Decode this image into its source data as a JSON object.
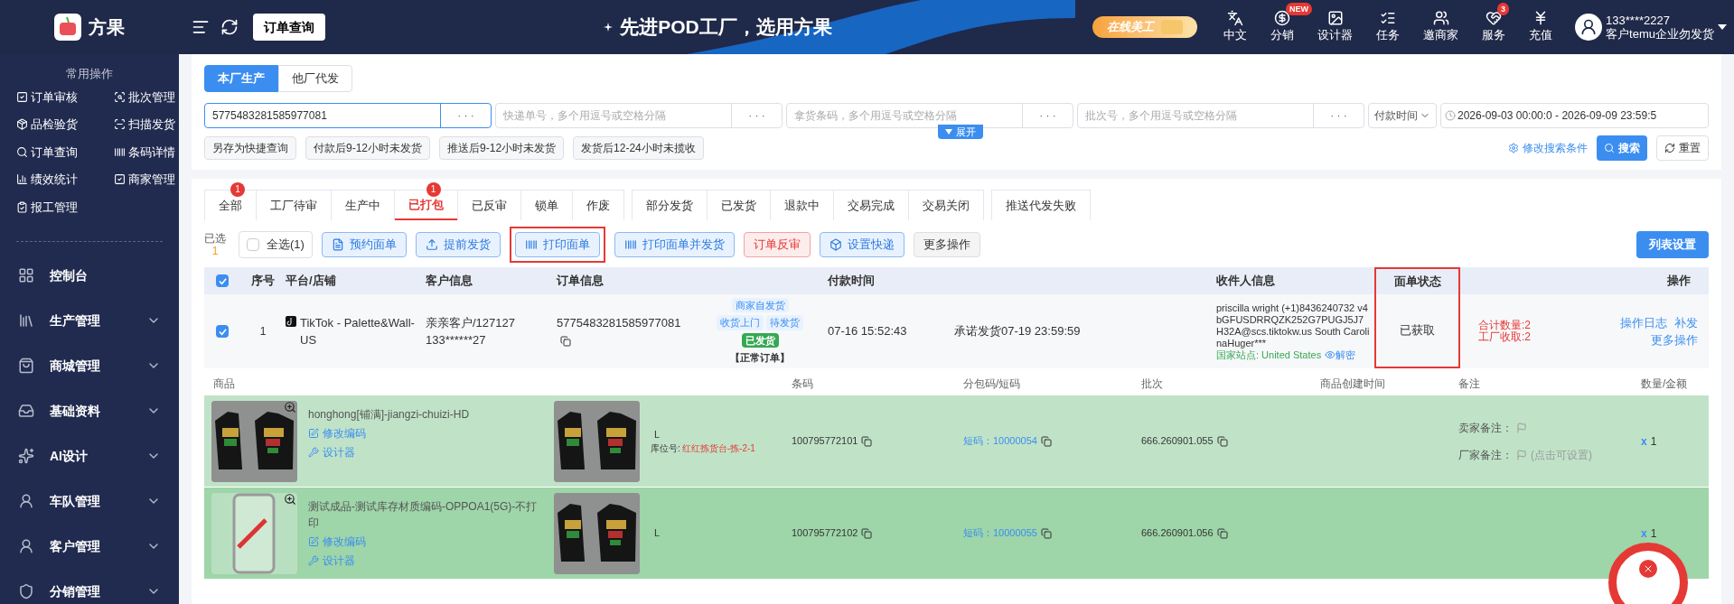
{
  "brand": {
    "name": "方果"
  },
  "topbar": {
    "current_page": "订单查询",
    "slogan": "先进POD工厂，选用方果",
    "promo": "在线美工",
    "nav": [
      {
        "label": "中文"
      },
      {
        "label": "分销",
        "badge": "NEW"
      },
      {
        "label": "设计器"
      },
      {
        "label": "任务"
      },
      {
        "label": "邀商家"
      },
      {
        "label": "服务",
        "badge": "3"
      },
      {
        "label": "充值"
      }
    ],
    "user": {
      "phone": "133****2227",
      "account": "客户temu企业勿发货"
    }
  },
  "sidebar": {
    "quick_title": "常用操作",
    "quick_items": [
      "订单审核",
      "批次管理",
      "品检验货",
      "扫描发货",
      "订单查询",
      "条码详情",
      "绩效统计",
      "商家管理",
      "报工管理"
    ],
    "menu": [
      {
        "label": "控制台",
        "kind": "link"
      },
      {
        "label": "生产管理",
        "kind": "group",
        "expanded": false
      },
      {
        "label": "商城管理",
        "kind": "group",
        "expanded": false
      },
      {
        "label": "基础资料",
        "kind": "group",
        "expanded": false
      },
      {
        "label": "AI设计",
        "kind": "group",
        "expanded": false
      },
      {
        "label": "车队管理",
        "kind": "group",
        "expanded": false
      },
      {
        "label": "客户管理",
        "kind": "group",
        "expanded": false
      },
      {
        "label": "分销管理",
        "kind": "group",
        "expanded": false
      }
    ]
  },
  "source_tabs": [
    {
      "label": "本厂生产",
      "selected": true
    },
    {
      "label": "他厂代发",
      "selected": false
    }
  ],
  "search": {
    "fields": [
      {
        "value": "5775483281585977081",
        "focused": true
      },
      {
        "placeholder": "快递单号，多个用逗号或空格分隔",
        "focused": false
      },
      {
        "placeholder": "拿货条码，多个用逗号或空格分隔",
        "focused": false
      },
      {
        "placeholder": "批次号，多个用逗号或空格分隔",
        "focused": false
      }
    ],
    "more": "· · ·",
    "time_type": "付款时间",
    "date_range": "2026-09-03 00:00:0 - 2026-09-09 23:59:5",
    "quick_queries": [
      "另存为快捷查询",
      "付款后9-12小时未发货",
      "推送后9-12小时未发货",
      "发货后12-24小时未揽收"
    ],
    "expand": "展开",
    "edit_conditions": "修改搜索条件",
    "search_button": "搜索",
    "reset_button": "重置"
  },
  "status_tabs": [
    [
      {
        "label": "全部",
        "selected": false,
        "badge": "1"
      },
      {
        "label": "工厂待审",
        "selected": false
      },
      {
        "label": "生产中",
        "selected": false
      },
      {
        "label": "已打包",
        "selected": true,
        "badge": "1"
      },
      {
        "label": "已反审",
        "selected": false
      },
      {
        "label": "锁单",
        "selected": false
      },
      {
        "label": "作废",
        "selected": false
      }
    ],
    [
      {
        "label": "部分发货",
        "selected": false
      },
      {
        "label": "已发货",
        "selected": false
      },
      {
        "label": "退款中",
        "selected": false
      },
      {
        "label": "交易完成",
        "selected": false
      },
      {
        "label": "交易关闭",
        "selected": false
      }
    ],
    [
      {
        "label": "推送代发失败",
        "selected": false
      }
    ]
  ],
  "actions": {
    "selected_label": "已选",
    "selected_count": "1",
    "select_all": {
      "label": "全选(1)",
      "checked": false
    },
    "buttons": [
      {
        "label": "预约面单",
        "kind": "blue",
        "highlighted": false
      },
      {
        "label": "提前发货",
        "kind": "blue",
        "highlighted": false
      },
      {
        "label": "打印面单",
        "kind": "blue",
        "highlighted": true
      },
      {
        "label": "打印面单并发货",
        "kind": "blue",
        "highlighted": false
      },
      {
        "label": "订单反审",
        "kind": "red",
        "highlighted": false
      },
      {
        "label": "设置快递",
        "kind": "blue",
        "highlighted": false
      },
      {
        "label": "更多操作",
        "kind": "plain",
        "highlighted": false
      }
    ],
    "list_settings": "列表设置"
  },
  "table": {
    "all_checked": true,
    "columns": [
      "序号",
      "平台/店铺",
      "客户信息",
      "订单信息",
      "付款时间",
      "收件人信息",
      "面单状态",
      "操作"
    ],
    "label_status_highlighted": true,
    "order": {
      "checked": true,
      "index": "1",
      "shop": "TikTok - Palette&Wall-US",
      "customer": "亲亲客户/127127 133******27",
      "order_no": "5775483281585977081",
      "tags": [
        {
          "label": "商家自发货",
          "kind": "info"
        },
        {
          "label": "收货上门",
          "kind": "info"
        },
        {
          "label": "待发货",
          "kind": "info"
        },
        {
          "label": "已发货",
          "kind": "done"
        }
      ],
      "order_type": "【正常订单】",
      "pay_time": "07-16 15:52:43",
      "promise": "承诺发货07-19 23:59:59",
      "recipient": "priscilla wright (+1)8436240732 v4bGFUSDRRQZK252G7PUGJ5J7H32A@scs.tiktokw.us South CarolinaHuger***",
      "decrypt": "解密",
      "country": "国家站点: United States",
      "label_status": "已获取",
      "totals": [
        "合计数量:2",
        "工厂收取:2"
      ],
      "operations": [
        "操作日志",
        "补发",
        "更多操作"
      ]
    }
  },
  "items": {
    "columns": [
      "商品",
      "条码",
      "分包码/短码",
      "批次",
      "商品创建时间",
      "备注",
      "数量/金额"
    ],
    "rows": [
      {
        "kind": "shirt",
        "name": "honghong[铺满]-jiangzi-chuizi-HD",
        "edit": "修改编码",
        "designer": "设计器",
        "size": "L",
        "location_label": "库位号:",
        "location": "红红拣货台-拣-2-1",
        "barcode": "100795772101",
        "short_code": "短码：10000054",
        "batch": "666.260901.055",
        "notes": [
          {
            "label": "卖家备注："
          },
          {
            "label": "厂家备注：",
            "hint": "(点击可设置)"
          }
        ],
        "qty_x": "x",
        "qty": "1"
      },
      {
        "kind": "phone",
        "name": "测试成品-测试库存材质编码-OPPOA1(5G)-不打印",
        "edit": "修改编码",
        "designer": "设计器",
        "size": "L",
        "barcode": "100795772102",
        "short_code": "短码：10000055",
        "batch": "666.260901.056",
        "qty_x": "x",
        "qty": "1"
      }
    ]
  }
}
